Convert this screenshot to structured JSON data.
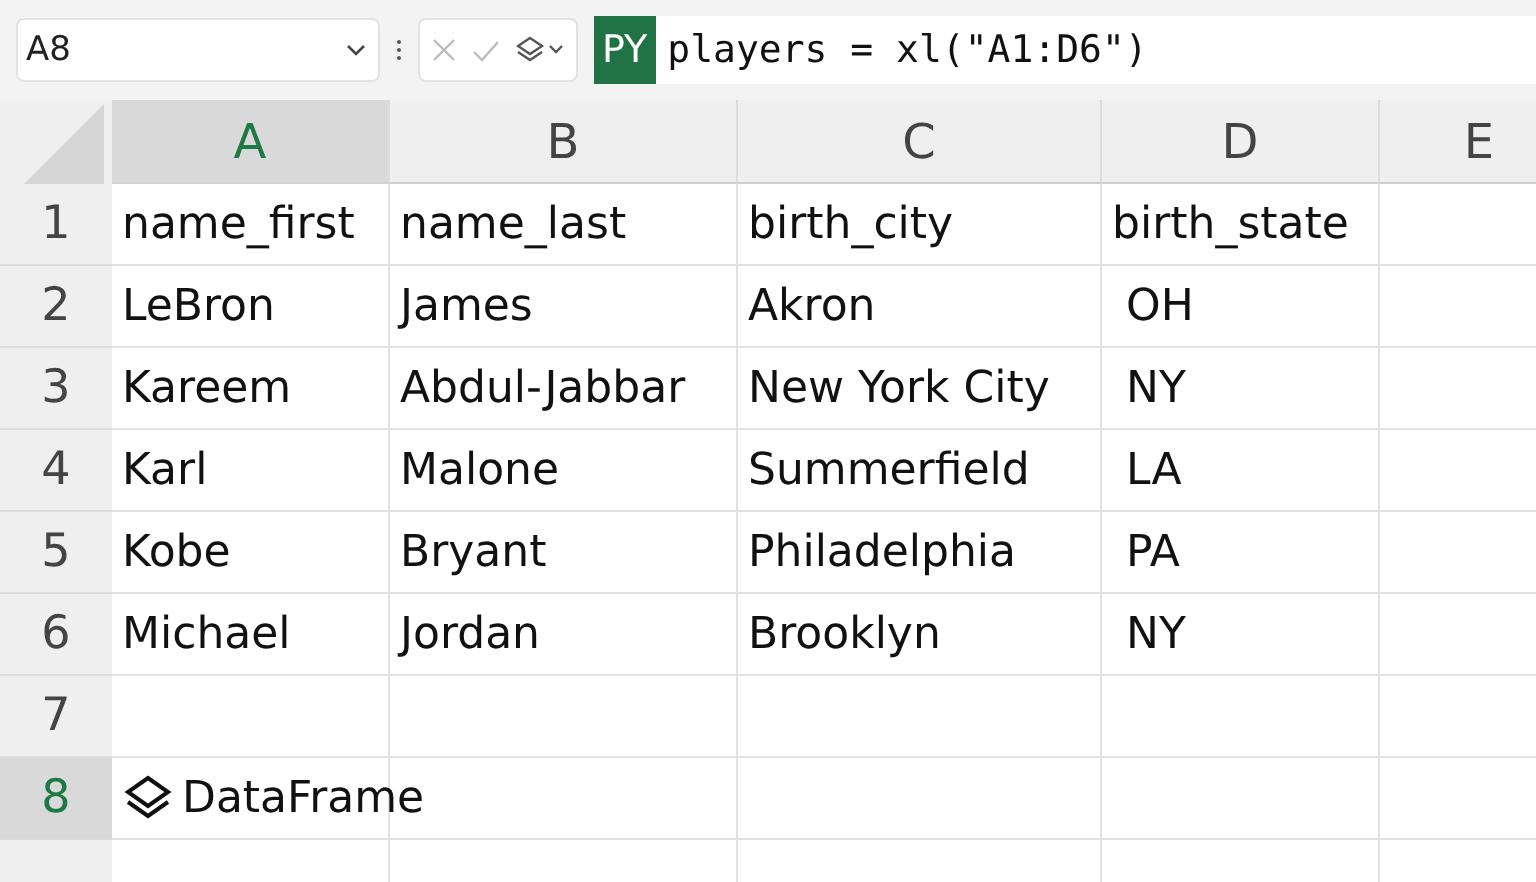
{
  "name_box": {
    "value": "A8"
  },
  "formula_bar": {
    "badge": "PY",
    "formula": "players = xl(\"A1:D6\")"
  },
  "columns": [
    {
      "label": "A",
      "selected": true
    },
    {
      "label": "B",
      "selected": false
    },
    {
      "label": "C",
      "selected": false
    },
    {
      "label": "D",
      "selected": false
    },
    {
      "label": "E",
      "selected": false
    }
  ],
  "rows": [
    {
      "label": "1",
      "selected": false,
      "cells": [
        {
          "text": "name_first"
        },
        {
          "text": "name_last"
        },
        {
          "text": "birth_city"
        },
        {
          "text": "birth_state"
        }
      ]
    },
    {
      "label": "2",
      "selected": false,
      "cells": [
        {
          "text": "LeBron"
        },
        {
          "text": "James"
        },
        {
          "text": "Akron"
        },
        {
          "text": "OH"
        }
      ]
    },
    {
      "label": "3",
      "selected": false,
      "cells": [
        {
          "text": "Kareem"
        },
        {
          "text": "Abdul-Jabbar"
        },
        {
          "text": "New York City"
        },
        {
          "text": "NY"
        }
      ]
    },
    {
      "label": "4",
      "selected": false,
      "cells": [
        {
          "text": "Karl"
        },
        {
          "text": "Malone"
        },
        {
          "text": "Summerfield"
        },
        {
          "text": "LA"
        }
      ]
    },
    {
      "label": "5",
      "selected": false,
      "cells": [
        {
          "text": "Kobe"
        },
        {
          "text": "Bryant"
        },
        {
          "text": "Philadelphia"
        },
        {
          "text": "PA"
        }
      ]
    },
    {
      "label": "6",
      "selected": false,
      "cells": [
        {
          "text": "Michael"
        },
        {
          "text": "Jordan"
        },
        {
          "text": "Brooklyn"
        },
        {
          "text": "NY"
        }
      ]
    },
    {
      "label": "7",
      "selected": false,
      "cells": []
    },
    {
      "label": "8",
      "selected": true,
      "cells": [
        {
          "text": "DataFrame",
          "kind": "python_object"
        }
      ]
    },
    {
      "selected": false,
      "cells": []
    }
  ]
}
